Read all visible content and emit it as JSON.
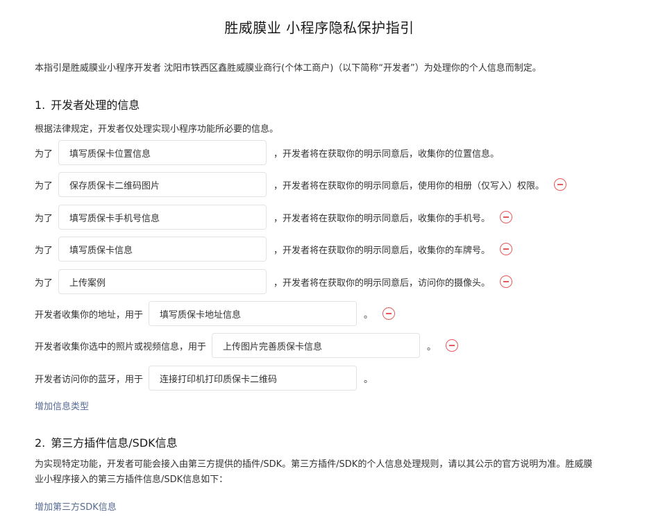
{
  "page": {
    "title": "胜威膜业 小程序隐私保护指引",
    "intro": "本指引是胜威膜业小程序开发者 沈阳市铁西区鑫胜威膜业商行(个体工商户)（以下简称“开发者”）为处理你的个人信息而制定。"
  },
  "section1": {
    "number": "1.",
    "title": "开发者处理的信息",
    "desc": "根据法律规定，开发者仅处理实现小程序功能所必要的信息。",
    "items": [
      {
        "prefix": "为了",
        "value": "填写质保卡位置信息",
        "suffix": "，开发者将在获取你的明示同意后，收集你的位置信息。"
      },
      {
        "prefix": "为了",
        "value": "保存质保卡二维码图片",
        "suffix": "，开发者将在获取你的明示同意后，使用你的相册（仅写入）权限。"
      },
      {
        "prefix": "为了",
        "value": "填写质保卡手机号信息",
        "suffix": "，开发者将在获取你的明示同意后，收集你的手机号。"
      },
      {
        "prefix": "为了",
        "value": "填写质保卡信息",
        "suffix": "，开发者将在获取你的明示同意后，收集你的车牌号。"
      },
      {
        "prefix": "为了",
        "value": "上传案例",
        "suffix": "，开发者将在获取你的明示同意后，访问你的摄像头。"
      },
      {
        "prefix": "开发者收集你的地址，用于",
        "value": "填写质保卡地址信息",
        "suffix": "。"
      },
      {
        "prefix": "开发者收集你选中的照片或视频信息，用于",
        "value": "上传图片完善质保卡信息",
        "suffix": "。"
      },
      {
        "prefix": "开发者访问你的蓝牙，用于",
        "value": "连接打印机打印质保卡二维码",
        "suffix": "。"
      }
    ],
    "add_link": "增加信息类型"
  },
  "section2": {
    "number": "2.",
    "title": "第三方插件信息/SDK信息",
    "desc": "为实现特定功能，开发者可能会接入由第三方提供的插件/SDK。第三方插件/SDK的个人信息处理规则，请以其公示的官方说明为准。胜威膜业小程序接入的第三方插件信息/SDK信息如下：",
    "add_link": "增加第三方SDK信息"
  },
  "colors": {
    "link": "#576b95",
    "remove_icon": "#e8585a",
    "input_border": "#e3e3e3"
  }
}
